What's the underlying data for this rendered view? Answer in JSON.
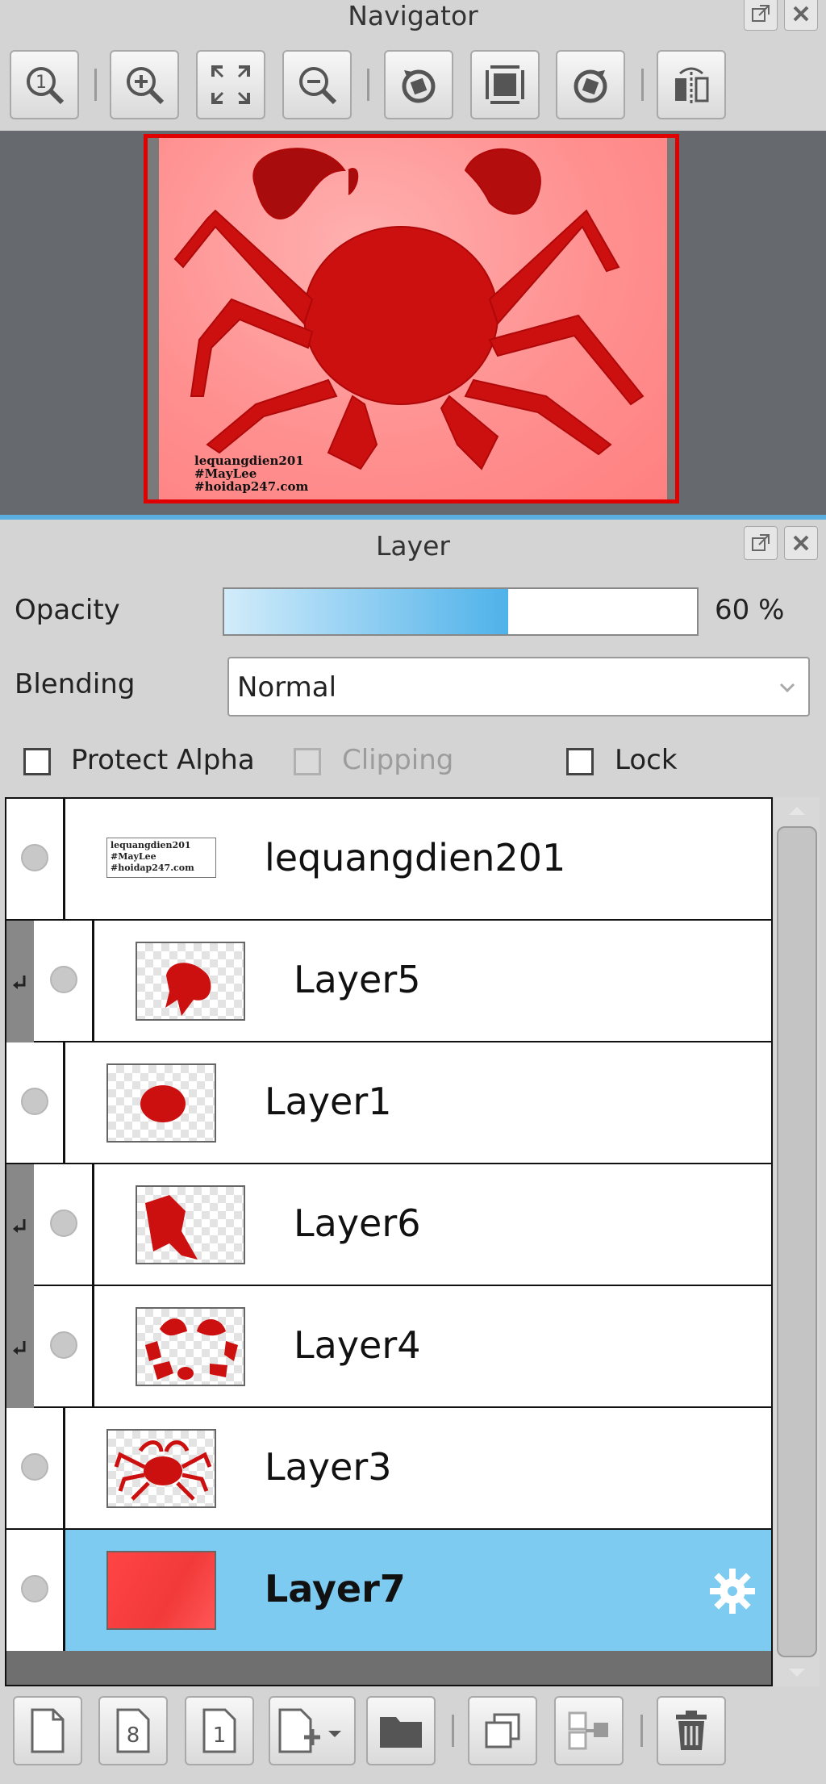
{
  "navigator": {
    "title": "Navigator",
    "toolbar": [
      "zoom-actual-size-icon",
      "zoom-in-icon",
      "fit-to-window-icon",
      "zoom-out-icon",
      "rotate-left-icon",
      "rotate-reset-icon",
      "rotate-right-icon",
      "flip-horizontal-icon"
    ],
    "preview_caption": [
      "lequangdien201",
      "#MayLee",
      "#hoidap247.com"
    ]
  },
  "layer": {
    "title": "Layer",
    "opacity_label": "Opacity",
    "opacity_value": 60,
    "opacity_text": "60 %",
    "blending_label": "Blending",
    "blending_value": "Normal",
    "protect_alpha_label": "Protect Alpha",
    "clipping_label": "Clipping",
    "lock_label": "Lock",
    "layers": [
      {
        "name": "lequangdien201",
        "clipped": false,
        "selected": false,
        "thumb_text": [
          "lequangdien201",
          "#MayLee",
          "#hoidap247.com"
        ]
      },
      {
        "name": "Layer5",
        "clipped": true,
        "selected": false
      },
      {
        "name": "Layer1",
        "clipped": false,
        "selected": false
      },
      {
        "name": "Layer6",
        "clipped": true,
        "selected": false
      },
      {
        "name": "Layer4",
        "clipped": true,
        "selected": false
      },
      {
        "name": "Layer3",
        "clipped": false,
        "selected": false
      },
      {
        "name": "Layer7",
        "clipped": false,
        "selected": true
      }
    ],
    "bottom_toolbar": [
      "new-layer-icon",
      "new-8bit-layer-icon",
      "new-1bit-layer-icon",
      "new-layer-menu-icon",
      "new-folder-icon",
      "duplicate-layer-icon",
      "merge-down-icon",
      "delete-layer-icon"
    ]
  },
  "colors": {
    "accent": "#7ecbf2",
    "crab": "#cc1010",
    "canvas": "#ff8c8c",
    "selection_frame": "#e00000"
  }
}
